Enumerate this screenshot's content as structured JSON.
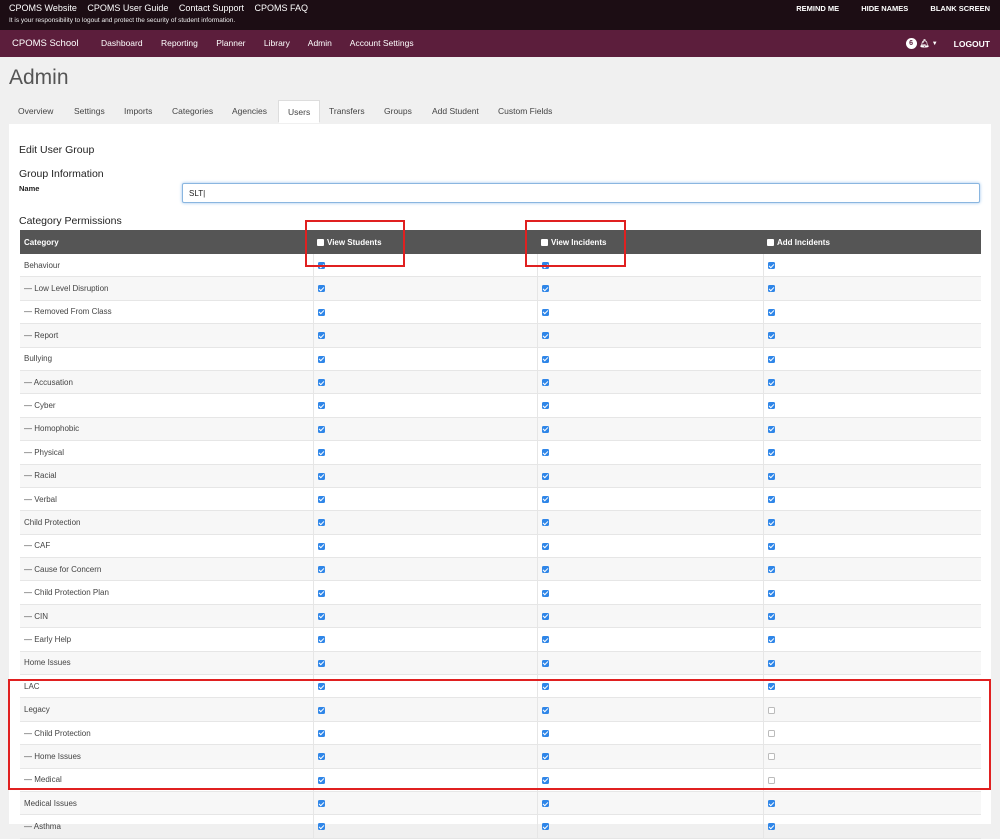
{
  "topbar": {
    "links": [
      "CPOMS Website",
      "CPOMS User Guide",
      "Contact Support",
      "CPOMS FAQ"
    ],
    "notice": "It is your responsibility to logout and protect the security of student information.",
    "actions": [
      "REMIND ME",
      "HIDE NAMES",
      "BLANK SCREEN"
    ]
  },
  "nav": {
    "brand": "CPOMS School",
    "items": [
      "Dashboard",
      "Reporting",
      "Planner",
      "Library",
      "Admin",
      "Account Settings"
    ],
    "badge": "6",
    "logout": "LOGOUT"
  },
  "page": {
    "title": "Admin"
  },
  "tabs": [
    "Overview",
    "Settings",
    "Imports",
    "Categories",
    "Agencies",
    "Users",
    "Transfers",
    "Groups",
    "Add Student",
    "Custom Fields"
  ],
  "active_tab": "Users",
  "form": {
    "heading": "Edit User Group",
    "group_info": "Group Information",
    "name_label": "Name",
    "name_value": "SLT|",
    "permissions_heading": "Category Permissions"
  },
  "table": {
    "headers": [
      "Category",
      "View Students",
      "View Incidents",
      "Add Incidents"
    ],
    "rows": [
      {
        "name": "Behaviour",
        "view_students": true,
        "view_incidents": true,
        "add_incidents": true
      },
      {
        "name": "— Low Level Disruption",
        "view_students": true,
        "view_incidents": true,
        "add_incidents": true
      },
      {
        "name": "— Removed From Class",
        "view_students": true,
        "view_incidents": true,
        "add_incidents": true
      },
      {
        "name": "— Report",
        "view_students": true,
        "view_incidents": true,
        "add_incidents": true
      },
      {
        "name": "Bullying",
        "view_students": true,
        "view_incidents": true,
        "add_incidents": true
      },
      {
        "name": "— Accusation",
        "view_students": true,
        "view_incidents": true,
        "add_incidents": true
      },
      {
        "name": "— Cyber",
        "view_students": true,
        "view_incidents": true,
        "add_incidents": true
      },
      {
        "name": "— Homophobic",
        "view_students": true,
        "view_incidents": true,
        "add_incidents": true
      },
      {
        "name": "— Physical",
        "view_students": true,
        "view_incidents": true,
        "add_incidents": true
      },
      {
        "name": "— Racial",
        "view_students": true,
        "view_incidents": true,
        "add_incidents": true
      },
      {
        "name": "— Verbal",
        "view_students": true,
        "view_incidents": true,
        "add_incidents": true
      },
      {
        "name": "Child Protection",
        "view_students": true,
        "view_incidents": true,
        "add_incidents": true
      },
      {
        "name": "— CAF",
        "view_students": true,
        "view_incidents": true,
        "add_incidents": true
      },
      {
        "name": "— Cause for Concern",
        "view_students": true,
        "view_incidents": true,
        "add_incidents": true
      },
      {
        "name": "— Child Protection Plan",
        "view_students": true,
        "view_incidents": true,
        "add_incidents": true
      },
      {
        "name": "— CIN",
        "view_students": true,
        "view_incidents": true,
        "add_incidents": true
      },
      {
        "name": "— Early Help",
        "view_students": true,
        "view_incidents": true,
        "add_incidents": true
      },
      {
        "name": "Home Issues",
        "view_students": true,
        "view_incidents": true,
        "add_incidents": true
      },
      {
        "name": "LAC",
        "view_students": true,
        "view_incidents": true,
        "add_incidents": true
      },
      {
        "name": "Legacy",
        "view_students": true,
        "view_incidents": true,
        "add_incidents": false
      },
      {
        "name": "— Child Protection",
        "view_students": true,
        "view_incidents": true,
        "add_incidents": false
      },
      {
        "name": "— Home Issues",
        "view_students": true,
        "view_incidents": true,
        "add_incidents": false
      },
      {
        "name": "— Medical",
        "view_students": true,
        "view_incidents": true,
        "add_incidents": false
      },
      {
        "name": "Medical Issues",
        "view_students": true,
        "view_incidents": true,
        "add_incidents": true
      },
      {
        "name": "— Asthma",
        "view_students": true,
        "view_incidents": true,
        "add_incidents": true
      }
    ]
  },
  "colors": {
    "topbar": "#1c0d14",
    "navbar": "#5c1e3c",
    "header_row": "#555555",
    "checkbox": "#2f86e8",
    "annotation": "#e02020"
  }
}
